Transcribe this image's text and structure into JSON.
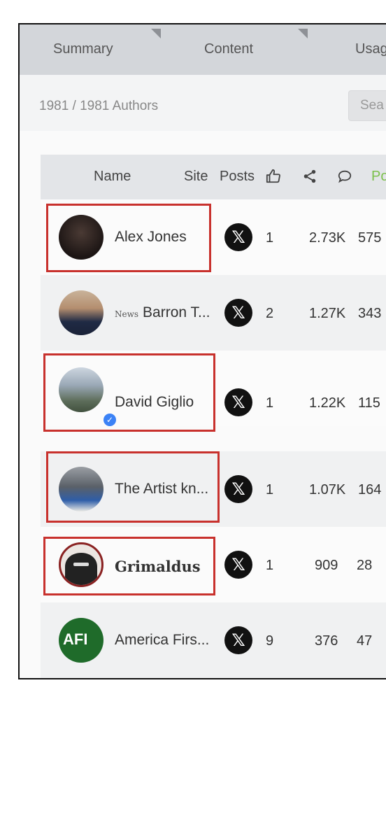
{
  "tabs": [
    {
      "label": "Summary"
    },
    {
      "label": "Content"
    },
    {
      "label": "Usag"
    }
  ],
  "toolbar": {
    "count_text": "1981 / 1981 Authors",
    "search_placeholder": "Sea"
  },
  "table": {
    "headers": {
      "name": "Name",
      "site": "Site",
      "posts": "Posts",
      "extra": "Po"
    },
    "header_icons": [
      "thumbs-up-icon",
      "share-icon",
      "comment-icon"
    ],
    "rows": [
      {
        "name": "Alex Jones",
        "prefix": "",
        "site_icon": "x-logo-icon",
        "posts": "1",
        "likes": "2.73K",
        "shares": "575",
        "highlighted": true,
        "verified": false
      },
      {
        "name": "Barron T...",
        "prefix": "News",
        "site_icon": "x-logo-icon",
        "posts": "2",
        "likes": "1.27K",
        "shares": "343",
        "highlighted": false,
        "verified": false
      },
      {
        "name": "David Giglio",
        "prefix": "",
        "site_icon": "x-logo-icon",
        "posts": "1",
        "likes": "1.22K",
        "shares": "115",
        "highlighted": true,
        "verified": true
      },
      {
        "name": "The Artist kn...",
        "prefix": "",
        "site_icon": "x-logo-icon",
        "posts": "1",
        "likes": "1.07K",
        "shares": "164",
        "highlighted": true,
        "verified": false
      },
      {
        "name": "Grimaldus",
        "prefix": "",
        "site_icon": "x-logo-icon",
        "posts": "1",
        "likes": "909",
        "shares": "28",
        "highlighted": true,
        "verified": false
      },
      {
        "name": "America Firs...",
        "prefix": "",
        "avatar_text": "AFI",
        "site_icon": "x-logo-icon",
        "posts": "9",
        "likes": "376",
        "shares": "47",
        "highlighted": false,
        "verified": false
      }
    ]
  },
  "colors": {
    "highlight_box": "#c8312d",
    "tab_bar": "#d3d6da",
    "verified_badge": "#3b82f6",
    "afi_green": "#2e7d32",
    "posted_column_green": "#7cc04b"
  }
}
